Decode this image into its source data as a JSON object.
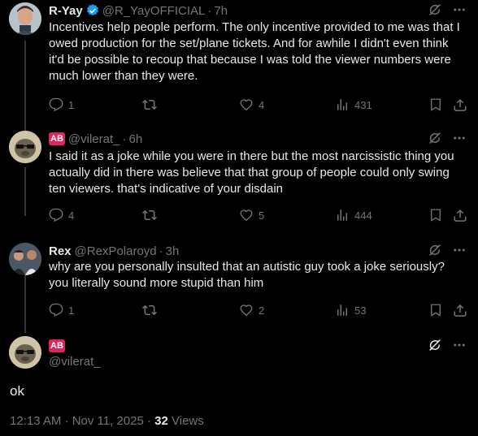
{
  "tweets": [
    {
      "name": "R-Yay",
      "handle": "@R_YayOFFICIAL",
      "time": "7h",
      "text": "Incentives help people perform. The only incentive provided to me was that I owed production for the set/plane tickets. And for awhile I didn't even think it'd be possible to recoup that because I was told the viewer numbers were much lower than they were.",
      "replies": "1",
      "retweets": "",
      "likes": "4",
      "views": "431"
    },
    {
      "badge": "AB",
      "handle": "@vilerat_",
      "time": "6h",
      "text": "I said it as a joke while you were in there but the most narcissistic thing you actually did in there was believe that that group of people could only swing ten viewers. that's indicative of your disdain",
      "replies": "4",
      "retweets": "",
      "likes": "5",
      "views": "444"
    },
    {
      "name": "Rex",
      "handle": "@RexPolaroyd",
      "time": "3h",
      "text": "why are you personally insulted that an autistic guy took a joke seriously? you literally sound more stupid than him",
      "replies": "1",
      "retweets": "",
      "likes": "2",
      "views": "53"
    }
  ],
  "main": {
    "badge": "AB",
    "handle": "@vilerat_",
    "text": "ok",
    "timestamp": "12:13 AM · Nov 11, 2025 · ",
    "views_count": "32",
    "views_label": " Views"
  },
  "colors": {
    "background": "#000000",
    "text": "#e7e9ea",
    "muted": "#71767b",
    "verified": "#1d9bf0",
    "badge": "#e0245e"
  },
  "icons": [
    "grok-icon",
    "more-icon",
    "reply-icon",
    "retweet-icon",
    "like-icon",
    "views-icon",
    "bookmark-icon",
    "share-icon",
    "verified-icon"
  ]
}
